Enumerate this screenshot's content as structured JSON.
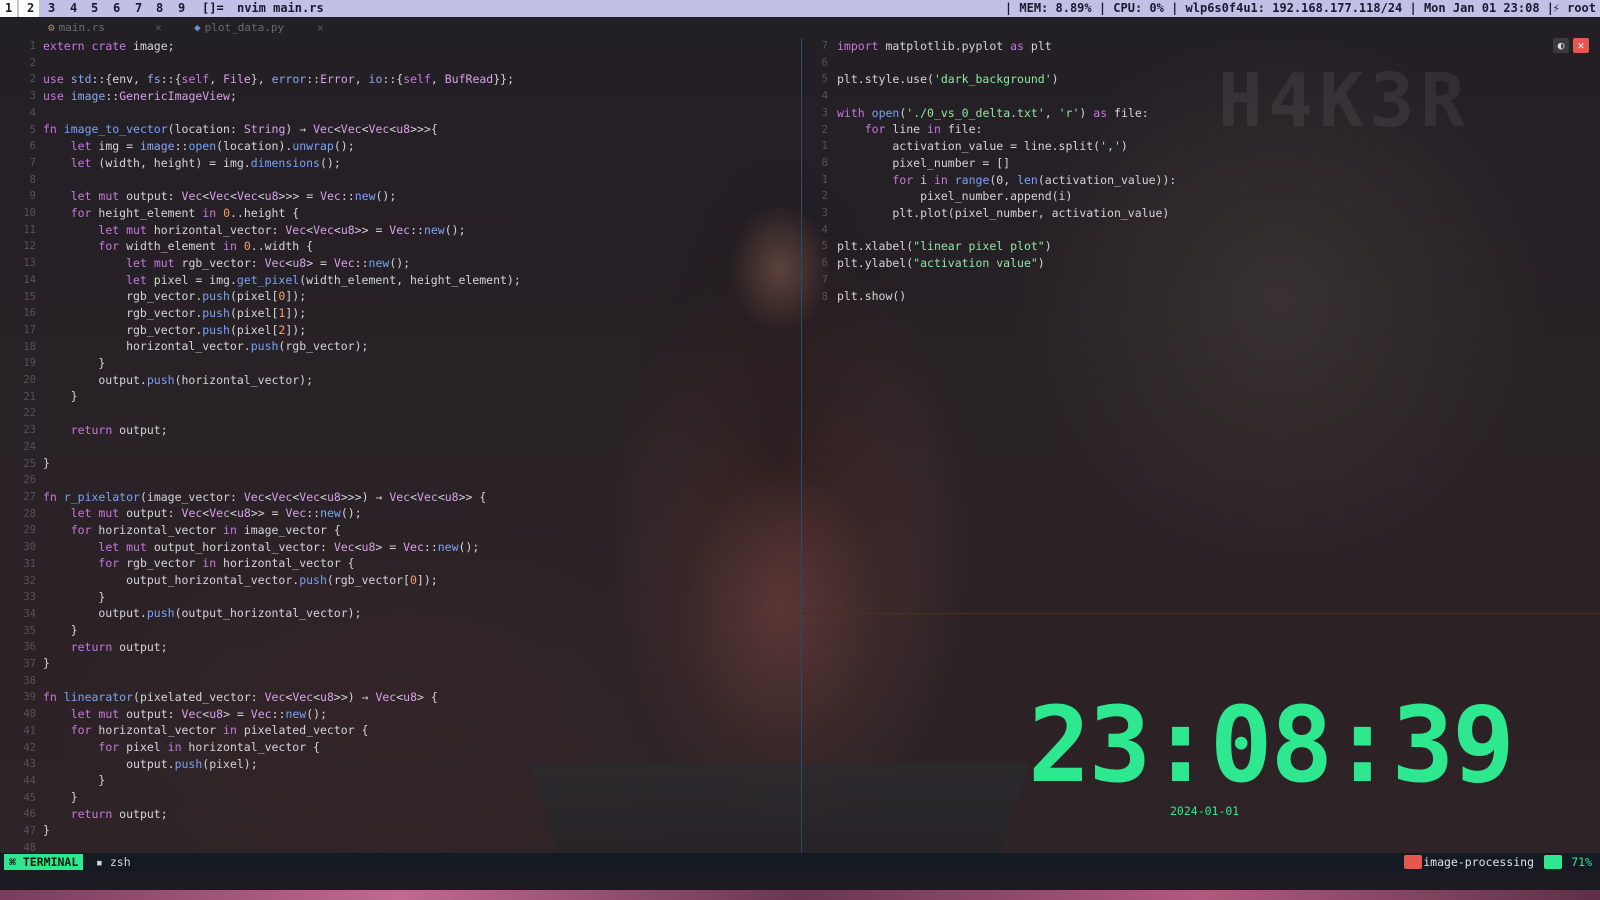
{
  "topbar": {
    "workspaces": [
      "1",
      "2",
      "3",
      "4",
      "5",
      "6",
      "7",
      "8",
      "9"
    ],
    "active_workspace": "2",
    "layout": "[]=",
    "title": "nvim main.rs",
    "stats": "| MEM: 8.89% | CPU: 0% | wlp6s0f4u1: 192.168.177.118/24 | Mon Jan 01 23:08 |",
    "user": "root"
  },
  "tabs": [
    {
      "label": "main.rs",
      "close": "✕"
    },
    {
      "label": "plot_data.py",
      "close": "✕"
    }
  ],
  "left_pane": {
    "line_numbers": "1\n2\n2\n3\n4\n5\n6\n7\n8\n9\n10\n11\n12\n13\n14\n15\n16\n17\n18\n19\n20\n21\n22\n23\n24\n25\n26\n27\n28\n29\n30\n31\n32\n33\n34\n35\n36\n37\n38\n39\n40\n41\n42\n43\n44\n45\n46\n47\n48",
    "lines": [
      "extern crate image;",
      "",
      "use std::{env, fs::{self, File}, error::Error, io::{self, BufRead}};",
      "use image::GenericImageView;",
      "",
      "fn image_to_vector(location: String) → Vec<Vec<Vec<u8>>>{",
      "    let img = image::open(location).unwrap();",
      "    let (width, height) = img.dimensions();",
      "",
      "    let mut output: Vec<Vec<Vec<u8>>> = Vec::new();",
      "    for height_element in 0..height {",
      "        let mut horizontal_vector: Vec<Vec<u8>> = Vec::new();",
      "        for width_element in 0..width {",
      "            let mut rgb_vector: Vec<u8> = Vec::new();",
      "            let pixel = img.get_pixel(width_element, height_element);",
      "            rgb_vector.push(pixel[0]);",
      "            rgb_vector.push(pixel[1]);",
      "            rgb_vector.push(pixel[2]);",
      "            horizontal_vector.push(rgb_vector);",
      "        }",
      "        output.push(horizontal_vector);",
      "    }",
      "",
      "    return output;",
      "",
      "}",
      "",
      "fn r_pixelator(image_vector: Vec<Vec<Vec<u8>>>) → Vec<Vec<u8>> {",
      "    let mut output: Vec<Vec<u8>> = Vec::new();",
      "    for horizontal_vector in image_vector {",
      "        let mut output_horizontal_vector: Vec<u8> = Vec::new();",
      "        for rgb_vector in horizontal_vector {",
      "            output_horizontal_vector.push(rgb_vector[0]);",
      "        }",
      "        output.push(output_horizontal_vector);",
      "    }",
      "    return output;",
      "}",
      "",
      "fn linearator(pixelated_vector: Vec<Vec<u8>>) → Vec<u8> {",
      "    let mut output: Vec<u8> = Vec::new();",
      "    for horizontal_vector in pixelated_vector {",
      "        for pixel in horizontal_vector {",
      "            output.push(pixel);",
      "        }",
      "    }",
      "    return output;",
      "}",
      ""
    ]
  },
  "right_pane": {
    "line_numbers": "7\n6\n5\n4\n3\n2\n1\n8\n1\n2\n3\n4\n5\n6\n7\n8",
    "lines": [
      "import matplotlib.pyplot as plt",
      "",
      "plt.style.use('dark_background')",
      "",
      "with open('./0_vs_0_delta.txt', 'r') as file:",
      "    for line in file:",
      "        activation_value = line.split(',')",
      "        pixel_number = []",
      "        for i in range(0, len(activation_value)):",
      "            pixel_number.append(i)",
      "        plt.plot(pixel_number, activation_value)",
      "",
      "plt.xlabel(\"linear pixel plot\")",
      "plt.ylabel(\"activation value\")",
      "",
      "plt.show()"
    ]
  },
  "watermark": "H4K3R",
  "clock": {
    "time": "23:08:39",
    "date": "2024-01-01"
  },
  "statusbar": {
    "mode": "TERMINAL",
    "shell": "zsh",
    "project": "image-processing",
    "percent": "71%"
  },
  "colors": {
    "accent_green": "#2ee88f",
    "topbar_bg": "#c3c0e8",
    "keyword": "#c678dd",
    "function": "#7aa2f7",
    "string": "#8ee6a0",
    "close_red": "#e5584f"
  }
}
